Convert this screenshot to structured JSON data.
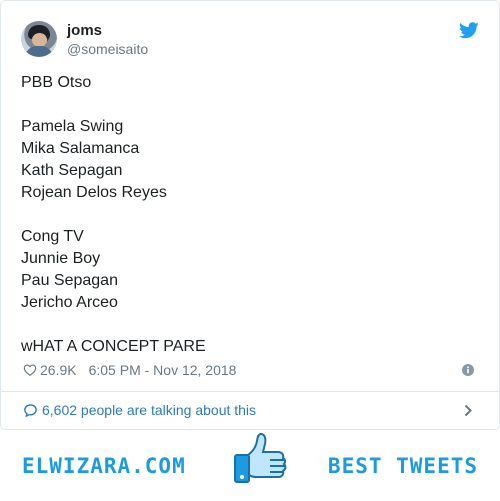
{
  "tweet": {
    "display_name": "joms",
    "handle": "@someisaito",
    "lines": [
      "PBB Otso",
      "",
      "Pamela Swing",
      "Mika Salamanca",
      "Kath Sepagan",
      "Rojean Delos Reyes",
      "",
      "Cong TV",
      "Junnie Boy",
      "Pau Sepagan",
      "Jericho Arceo",
      "",
      "wHAT A CONCEPT PARE"
    ],
    "likes": "26.9K",
    "timestamp": "6:05 PM - Nov 12, 2018",
    "talking": "6,602 people are talking about this"
  },
  "footer": {
    "left_brand": "ELWIZARA.COM",
    "right_brand": "BEST TWEETS"
  },
  "icons": {
    "brand_logo": "twitter-bird-icon",
    "like": "heart-icon",
    "info": "info-icon",
    "conversation": "chat-bubble-icon",
    "chevron": "chevron-right-icon",
    "footer_logo": "thumbs-up-icon"
  },
  "colors": {
    "twitter_blue": "#1da1f2",
    "link_blue": "#2b7bb9",
    "muted_text": "#697882",
    "brand_blue": "#1d9be0",
    "border": "#e1e8ed"
  }
}
